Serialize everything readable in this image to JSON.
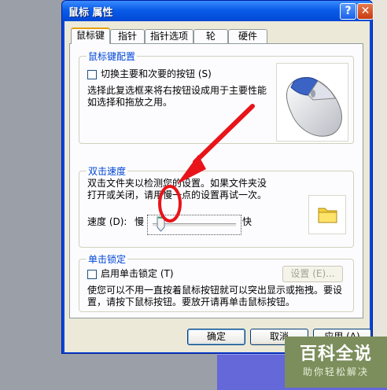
{
  "window": {
    "title": "鼠标 属性",
    "help_label": "?",
    "close_label": "✕"
  },
  "tabs": [
    {
      "label": "鼠标键",
      "active": true
    },
    {
      "label": "指针",
      "active": false
    },
    {
      "label": "指针选项",
      "active": false
    },
    {
      "label": "轮",
      "active": false
    },
    {
      "label": "硬件",
      "active": false
    }
  ],
  "button_config": {
    "group_title": "鼠标键配置",
    "checkbox_label": "切换主要和次要的按钮 (S)",
    "checked": false,
    "description_line1": "选择此复选框来将右按钮设成用于主要性能",
    "description_line2": "如选择和拖放之用。"
  },
  "double_click": {
    "group_title": "双击速度",
    "description_line1": "双击文件夹以检测您的设置。如果文件夹没",
    "description_line2": "打开或关闭，请用慢一点的设置再试一次。",
    "speed_label": "速度 (D):",
    "slow_label": "慢",
    "fast_label": "快",
    "speed_fraction": 0.1
  },
  "click_lock": {
    "group_title": "单击锁定",
    "checkbox_label": "启用单击锁定 (T)",
    "checked": false,
    "settings_label": "设置 (E)...",
    "description_line1": "使您可以不用一直按着鼠标按钮就可以突出显示或拖拽。要设",
    "description_line2": "置，请按下鼠标按钮。要放开请再单击鼠标按钮。"
  },
  "footer": {
    "ok_label": "确定",
    "cancel_label": "取消",
    "apply_label": "应用 (A)"
  },
  "watermark": {
    "title": "百科全说",
    "subtitle": "助你轻松解决"
  },
  "colors": {
    "annotation": "#e8141a",
    "group_title": "#0046d5",
    "titlebar": "#0a5ce8"
  }
}
